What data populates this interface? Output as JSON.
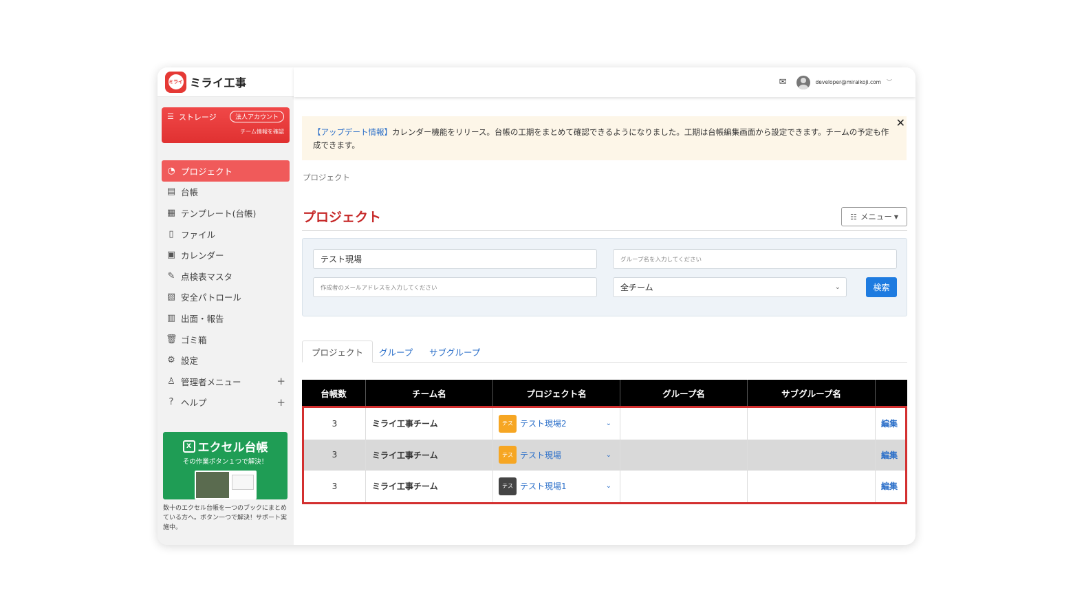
{
  "app": {
    "logo_mark": "ミライ",
    "name": "ミライ工事"
  },
  "storage": {
    "label": "ストレージ",
    "badge": "法人アカウント",
    "sub": "チーム情報を確認"
  },
  "sidebar": {
    "items": [
      {
        "label": "プロジェクト",
        "icon": "project-icon"
      },
      {
        "label": "台帳",
        "icon": "ledger-icon"
      },
      {
        "label": "テンプレート(台帳)",
        "icon": "template-icon"
      },
      {
        "label": "ファイル",
        "icon": "file-icon"
      },
      {
        "label": "カレンダー",
        "icon": "calendar-icon"
      },
      {
        "label": "点検表マスタ",
        "icon": "checklist-icon"
      },
      {
        "label": "安全パトロール",
        "icon": "patrol-icon"
      },
      {
        "label": "出面・報告",
        "icon": "report-icon"
      },
      {
        "label": "ゴミ箱",
        "icon": "trash-icon"
      },
      {
        "label": "設定",
        "icon": "gear-icon"
      },
      {
        "label": "管理者メニュー",
        "icon": "admin-icon"
      },
      {
        "label": "ヘルプ",
        "icon": "help-icon"
      }
    ]
  },
  "promo": {
    "xl_mark": "X",
    "title": "エクセル台帳",
    "sub": "その作業ボタン１つで解決！",
    "desc": "数十のエクセル台帳を一つのブックにまとめている方へ。ボタン一つで解決！サポート実施中。"
  },
  "header": {
    "email": "developer@miraikoji.com"
  },
  "notice": {
    "tag": "【アップデート情報】",
    "text": "カレンダー機能をリリース。台帳の工期をまとめて確認できるようになりました。工期は台帳編集画面から設定できます。チームの予定も作成できます。",
    "close": "✕"
  },
  "breadcrumb": "プロジェクト",
  "page_title": "プロジェクト",
  "menu_button": "メニュー",
  "filters": {
    "project_value": "テスト現場",
    "group_placeholder": "グループ名を入力してください",
    "email_placeholder": "作成者のメールアドレスを入力してください",
    "team_selected": "全チーム",
    "search_label": "検索"
  },
  "tabs": [
    {
      "label": "プロジェクト",
      "active": true
    },
    {
      "label": "グループ",
      "active": false
    },
    {
      "label": "サブグループ",
      "active": false
    }
  ],
  "table": {
    "headers": [
      "台帳数",
      "チーム名",
      "プロジェクト名",
      "グループ名",
      "サブグループ名",
      ""
    ],
    "rows": [
      {
        "count": "3",
        "team": "ミライ工事チーム",
        "badge": "テス",
        "project": "テスト現場2",
        "group": "",
        "subgroup": "",
        "edit": "編集"
      },
      {
        "count": "3",
        "team": "ミライ工事チーム",
        "badge": "テス",
        "project": "テスト現場",
        "group": "",
        "subgroup": "",
        "edit": "編集"
      },
      {
        "count": "3",
        "team": "ミライ工事チーム",
        "badge": "テス",
        "project": "テスト現場1",
        "group": "",
        "subgroup": "",
        "edit": "編集"
      }
    ]
  },
  "colors": {
    "accent": "#f05a5a",
    "title": "#c62828",
    "link": "#2b6fc9",
    "button": "#1e7be0",
    "highlight_border": "#d32f2f"
  }
}
